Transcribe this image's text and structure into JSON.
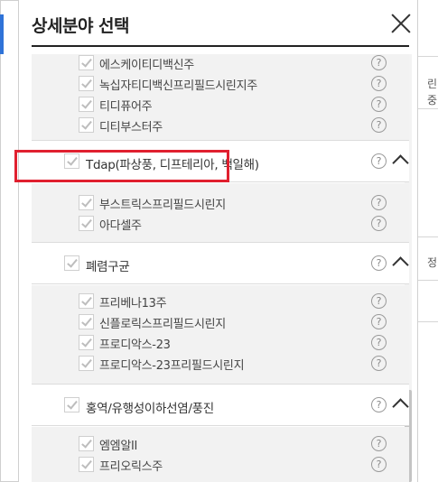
{
  "modal": {
    "title": "상세분야 선택",
    "close_label": "닫기"
  },
  "background": {
    "fragments": [
      "린",
      "중",
      "정"
    ]
  },
  "blocks": [
    {
      "type": "sub",
      "items": [
        {
          "label": "에스케이티디백신주",
          "help": "?"
        },
        {
          "label": "녹십자티디백신프리필드시린지주",
          "help": "?"
        },
        {
          "label": "티디퓨어주",
          "help": "?"
        },
        {
          "label": "디티부스터주",
          "help": "?"
        }
      ]
    },
    {
      "type": "group",
      "label": "Tdap(파상풍, 디프테리아, 백일해)",
      "help": "?"
    },
    {
      "type": "sub",
      "items": [
        {
          "label": "부스트릭스프리필드시린지",
          "help": "?"
        },
        {
          "label": "아다셀주",
          "help": "?"
        }
      ]
    },
    {
      "type": "group",
      "label": "폐렴구균",
      "help": "?"
    },
    {
      "type": "sub",
      "items": [
        {
          "label": "프리베나13주",
          "help": "?"
        },
        {
          "label": "신플로릭스프리필드시린지",
          "help": "?"
        },
        {
          "label": "프로디악스-23",
          "help": "?"
        },
        {
          "label": "프로디악스-23프리필드시린지",
          "help": "?"
        }
      ]
    },
    {
      "type": "group",
      "label": "홍역/유행성이하선염/풍진",
      "help": "?"
    },
    {
      "type": "sub",
      "items": [
        {
          "label": "엠엠알II",
          "help": "?"
        },
        {
          "label": "프리오릭스주",
          "help": "?"
        }
      ]
    }
  ],
  "colors": {
    "accent": "#2f73d8",
    "highlight": "#e0202f",
    "sub_bg": "#f2f2f2",
    "check": "#bdbdbd"
  }
}
